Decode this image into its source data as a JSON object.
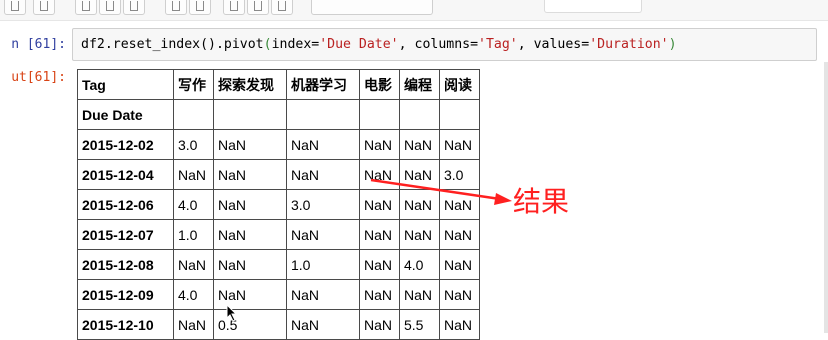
{
  "input_cell": {
    "prompt": "n [61]:",
    "code": {
      "p1": "df2.reset_index().pivot",
      "p2": "(",
      "p3": "index=",
      "p4": "'Due Date'",
      "p5": ", columns=",
      "p6": "'Tag'",
      "p7": ", values=",
      "p8": "'Duration'",
      "p9": ")"
    }
  },
  "output_cell": {
    "prompt": "ut[61]:"
  },
  "dataframe": {
    "columns_name": "Tag",
    "columns": [
      "写作",
      "探索发现",
      "机器学习",
      "电影",
      "编程",
      "阅读"
    ],
    "index_name": "Due Date",
    "rows": [
      {
        "index": "2015-12-02",
        "values": [
          "3.0",
          "NaN",
          "NaN",
          "NaN",
          "NaN",
          "NaN"
        ]
      },
      {
        "index": "2015-12-04",
        "values": [
          "NaN",
          "NaN",
          "NaN",
          "NaN",
          "NaN",
          "3.0"
        ]
      },
      {
        "index": "2015-12-06",
        "values": [
          "4.0",
          "NaN",
          "3.0",
          "NaN",
          "NaN",
          "NaN"
        ]
      },
      {
        "index": "2015-12-07",
        "values": [
          "1.0",
          "NaN",
          "NaN",
          "NaN",
          "NaN",
          "NaN"
        ]
      },
      {
        "index": "2015-12-08",
        "values": [
          "NaN",
          "NaN",
          "1.0",
          "NaN",
          "4.0",
          "NaN"
        ]
      },
      {
        "index": "2015-12-09",
        "values": [
          "4.0",
          "NaN",
          "NaN",
          "NaN",
          "NaN",
          "NaN"
        ]
      },
      {
        "index": "2015-12-10",
        "values": [
          "NaN",
          "0.5",
          "NaN",
          "NaN",
          "5.5",
          "NaN"
        ]
      }
    ]
  },
  "annotation": {
    "text": "结果",
    "color": "#ff2020"
  },
  "colors": {
    "in_prompt": "#303f9f",
    "out_prompt": "#d84315",
    "string": "#ba2121"
  }
}
